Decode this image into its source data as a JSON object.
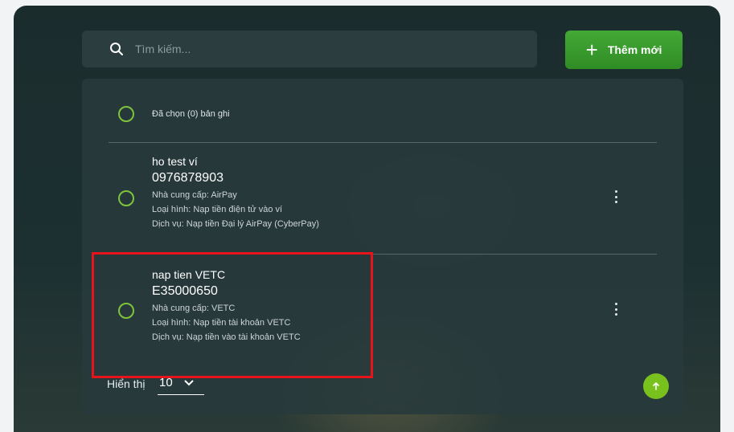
{
  "search": {
    "placeholder": "Tìm kiếm..."
  },
  "toolbar": {
    "add_label": "Thêm mới"
  },
  "list": {
    "selected_summary": "Đã chọn (0) bản ghi",
    "items": [
      {
        "name": "ho test ví",
        "code": "0976878903",
        "provider": "Nhà cung cấp: AirPay",
        "type": "Loại hình: Nạp tiền điện tử vào ví",
        "service": "Dịch vụ: Nạp tiền Đại lý AirPay (CyberPay)"
      },
      {
        "name": "nap tien VETC",
        "code": "E35000650",
        "provider": "Nhà cung cấp: VETC",
        "type": "Loại hình: Nạp tiền tài khoản VETC",
        "service": "Dịch vụ: Nạp tiền vào tài khoản VETC"
      }
    ]
  },
  "pagination": {
    "label": "Hiển thị",
    "page_size": "10"
  },
  "colors": {
    "accent": "#43a935",
    "radio": "#7ec33b",
    "highlight": "#e8141b",
    "fab": "#79c21e"
  },
  "icons": {
    "search": "search-icon",
    "add": "plus-icon",
    "more": "kebab-menu-icon",
    "dropdown": "chevron-down-icon",
    "scroll_top": "arrow-up-icon"
  }
}
